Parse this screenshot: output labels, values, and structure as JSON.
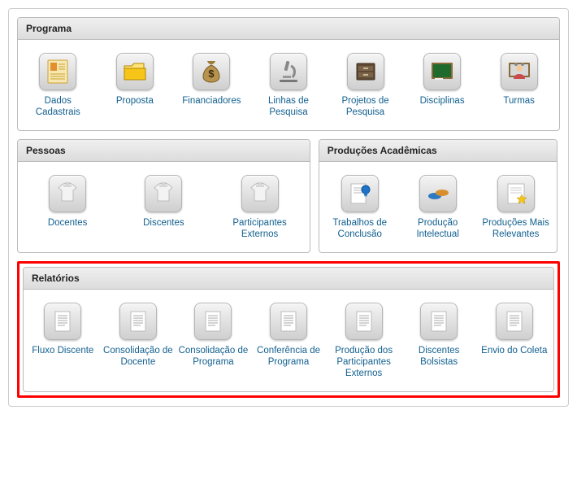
{
  "sections": {
    "programa": {
      "title": "Programa",
      "items": [
        {
          "label": "Dados Cadastrais",
          "icon": "form"
        },
        {
          "label": "Proposta",
          "icon": "folder"
        },
        {
          "label": "Financiadores",
          "icon": "money-bag"
        },
        {
          "label": "Linhas de Pesquisa",
          "icon": "microscope"
        },
        {
          "label": "Projetos de Pesquisa",
          "icon": "archive"
        },
        {
          "label": "Disciplinas",
          "icon": "chalkboard"
        },
        {
          "label": "Turmas",
          "icon": "teacher"
        }
      ]
    },
    "pessoas": {
      "title": "Pessoas",
      "items": [
        {
          "label": "Docentes",
          "icon": "shirt"
        },
        {
          "label": "Discentes",
          "icon": "shirt"
        },
        {
          "label": "Participantes Externos",
          "icon": "shirt"
        }
      ]
    },
    "producoes": {
      "title": "Produções Acadêmicas",
      "items": [
        {
          "label": "Trabalhos de Conclusão",
          "icon": "certificate"
        },
        {
          "label": "Produção Intelectual",
          "icon": "shoes"
        },
        {
          "label": "Produções Mais Relevantes",
          "icon": "star-page"
        }
      ]
    },
    "relatorios": {
      "title": "Relatórios",
      "items": [
        {
          "label": "Fluxo Discente",
          "icon": "report"
        },
        {
          "label": "Consolidação de Docente",
          "icon": "report"
        },
        {
          "label": "Consolidação de Programa",
          "icon": "report"
        },
        {
          "label": "Conferência de Programa",
          "icon": "report"
        },
        {
          "label": "Produção dos Participantes Externos",
          "icon": "report"
        },
        {
          "label": "Discentes Bolsistas",
          "icon": "report"
        },
        {
          "label": "Envio do Coleta",
          "icon": "report"
        }
      ]
    }
  },
  "highlighted_section": "relatorios",
  "colors": {
    "link": "#12608f",
    "panel_border": "#bbb",
    "highlight": "#ff0000"
  }
}
